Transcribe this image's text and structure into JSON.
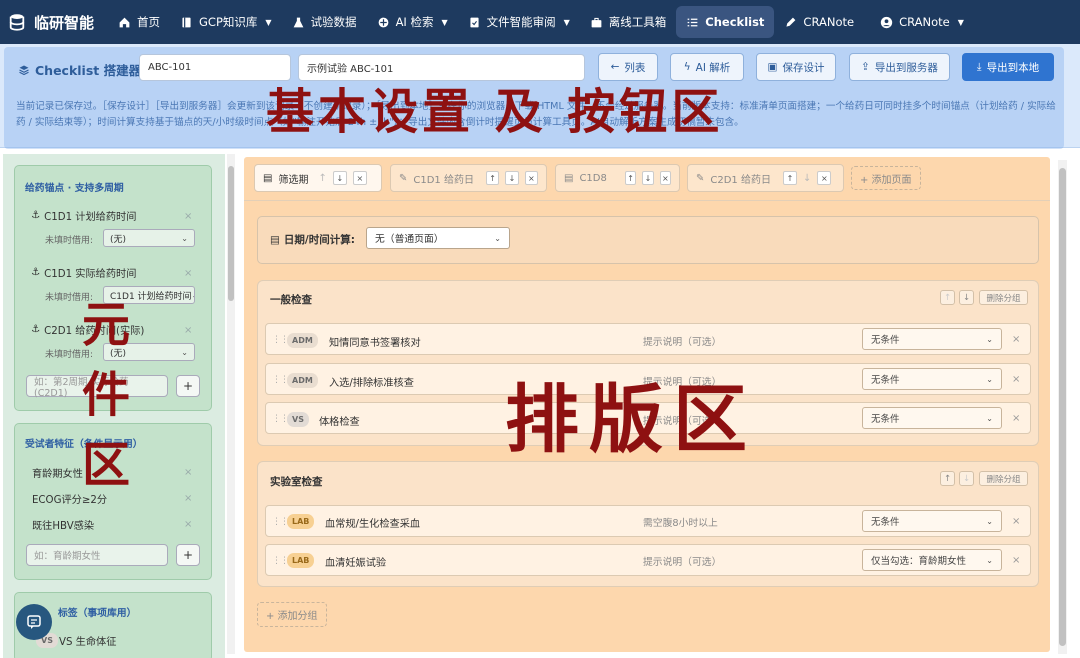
{
  "nav": {
    "brand": "临研智能",
    "items": [
      {
        "label": "首页",
        "icon": "home-icon",
        "dropdown": false
      },
      {
        "label": "GCP知识库",
        "icon": "book-icon",
        "dropdown": true
      },
      {
        "label": "试验数据",
        "icon": "flask-icon",
        "dropdown": false
      },
      {
        "label": "AI 检索",
        "icon": "ai-icon",
        "dropdown": true
      },
      {
        "label": "文件智能审阅",
        "icon": "file-check-icon",
        "dropdown": true
      },
      {
        "label": "离线工具箱",
        "icon": "toolbox-icon",
        "dropdown": false
      },
      {
        "label": "Checklist",
        "icon": "list-icon",
        "dropdown": false,
        "active": true
      },
      {
        "label": "CRANote",
        "icon": "note-icon",
        "dropdown": false
      },
      {
        "label": "CRANote",
        "icon": "user-icon",
        "dropdown": true
      }
    ]
  },
  "header": {
    "title": "Checklist 搭建器",
    "code_value": "ABC-101",
    "name_value": "示例试验 ABC-101",
    "buttons": {
      "list": "列表",
      "ai_parse": "AI 解析",
      "save": "保存设计",
      "export_server": "导出到服务器",
      "export_local": "导出到本地"
    },
    "note": "当前记录已保存过。［保存设计］［导出到服务器］会更新到该记录（不创建新记录）；［导出到本地］只在你的浏览器里下载 HTML 文件，不会经过服务器。当前版本支持：标准清单页面搭建；一个给药日可同时挂多个时间锚点（计划给药 / 实际给药 / 实际结束等）；时间计算支持基于锚点的天/小时级时间点（如\"输注开始后 24h ±1h\"）；导出文件内含倒计时提醒页与计算工具页。AI自动解析方案生成初稿暂未包含。",
    "overlay_label": "基本设置 及 按钮区"
  },
  "left": {
    "overlay_label": "元件区",
    "anchors_card": {
      "title": "给药锚点 · 支持多周期",
      "items": [
        {
          "label": "C1D1 计划给药时间",
          "fallback_label": "未填时借用:",
          "fallback_value": "(无)"
        },
        {
          "label": "C1D1 实际给药时间",
          "fallback_label": "未填时借用:",
          "fallback_value": "C1D1 计划给药时间"
        },
        {
          "label": "C2D1 给药时间(实际)",
          "fallback_label": "未填时借用:",
          "fallback_value": "(无)"
        }
      ],
      "add_placeholder": "如：第2周期 实际给药(C2D1)"
    },
    "traits_card": {
      "title": "受试者特征（条件显示用）",
      "items": [
        "育龄期女性",
        "ECOG评分≥2分",
        "既往HBV感染"
      ],
      "add_placeholder": "如：育龄期女性"
    },
    "tags_card": {
      "title": "标签（事项库用）",
      "items": [
        {
          "code": "VS",
          "label": "VS 生命体征"
        }
      ]
    }
  },
  "main": {
    "overlay_label": "排版区",
    "tabs": [
      {
        "label": "筛选期",
        "icon": "calendar-icon",
        "active": true
      },
      {
        "label": "C1D1 给药日",
        "icon": "pencil-icon",
        "active": false
      },
      {
        "label": "C1D8",
        "icon": "calendar-icon",
        "active": false
      },
      {
        "label": "C2D1 给药日",
        "icon": "pencil-icon",
        "active": false
      }
    ],
    "add_page": "+ 添加页面",
    "date_label": "日期/时间计算:",
    "date_value": "无（普通页面）",
    "delete_group": "删除分组",
    "groups": [
      {
        "title": "一般检查",
        "rows": [
          {
            "tag": "ADM",
            "name": "知情同意书签署核对",
            "hint": "提示说明（可选）",
            "condition": "无条件"
          },
          {
            "tag": "ADM",
            "name": "入选/排除标准核查",
            "hint": "提示说明（可选）",
            "condition": "无条件"
          },
          {
            "tag": "VS",
            "name": "体格检查",
            "hint": "提示说明（可选）",
            "condition": "无条件"
          }
        ]
      },
      {
        "title": "实验室检查",
        "rows": [
          {
            "tag": "LAB",
            "name": "血常规/生化检查采血",
            "hint": "需空腹8小时以上",
            "condition": "无条件"
          },
          {
            "tag": "LAB",
            "name": "血清妊娠试验",
            "hint": "提示说明（可选）",
            "condition": "仅当勾选：育龄期女性"
          }
        ]
      }
    ],
    "add_group": "+ 添加分组"
  },
  "colors": {
    "nav_bg": "#1e3a5f",
    "header_overlay": "#78aaeb",
    "left_overlay": "#98c9a8",
    "main_overlay": "#fdd7ad",
    "label_red": "#8e1111",
    "primary": "#2f74d0"
  }
}
